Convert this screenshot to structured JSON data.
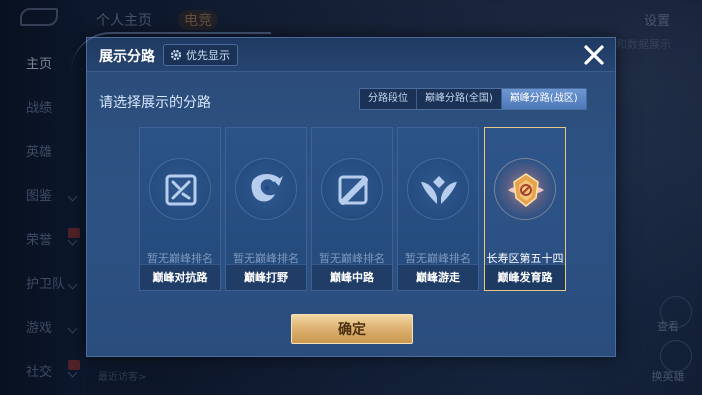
{
  "background": {
    "sidebar": [
      {
        "label": "主页",
        "active": true
      },
      {
        "label": "战绩"
      },
      {
        "label": "英雄"
      },
      {
        "label": "图鉴"
      },
      {
        "label": "荣誉"
      },
      {
        "label": "护卫队"
      },
      {
        "label": "游戏"
      },
      {
        "label": "社交"
      }
    ],
    "top_tabs": [
      "个人主页",
      "电竞"
    ],
    "settings_label": "设置",
    "data_link": "和数据展示",
    "bottom_text": "最近访客>",
    "right_buttons": [
      "查看",
      "换英雄"
    ]
  },
  "modal": {
    "title": "展示分路",
    "priority_button": "优先显示",
    "subtitle": "请选择展示的分路",
    "tabs": [
      {
        "label": "分路段位",
        "active": false
      },
      {
        "label": "巅峰分路(全国)",
        "active": false
      },
      {
        "label": "巅峰分路(战区)",
        "active": true
      }
    ],
    "cards": [
      {
        "rank": "暂无巅峰排名",
        "name": "巅峰对抗路",
        "icon": "clash-lane-icon",
        "selected": false
      },
      {
        "rank": "暂无巅峰排名",
        "name": "巅峰打野",
        "icon": "jungle-icon",
        "selected": false
      },
      {
        "rank": "暂无巅峰排名",
        "name": "巅峰中路",
        "icon": "mid-lane-icon",
        "selected": false
      },
      {
        "rank": "暂无巅峰排名",
        "name": "巅峰游走",
        "icon": "roam-icon",
        "selected": false
      },
      {
        "rank": "长寿区第五十四",
        "name": "巅峰发育路",
        "icon": "farm-lane-icon",
        "selected": true
      }
    ],
    "confirm_label": "确定"
  },
  "colors": {
    "accent_gold": "#e8c887",
    "active_tab": "#5b86c4",
    "modal_bg": "#2b4b78"
  }
}
